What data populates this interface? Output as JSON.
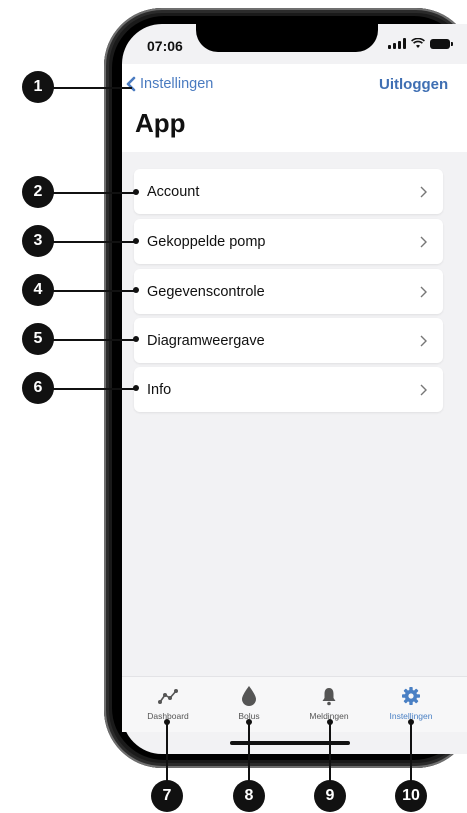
{
  "status_bar": {
    "time": "07:06"
  },
  "header": {
    "back_label": "Instellingen",
    "logout_label": "Uitloggen",
    "title": "App"
  },
  "menu": {
    "items": [
      {
        "label": "Account"
      },
      {
        "label": "Gekoppelde pomp"
      },
      {
        "label": "Gegevenscontrole"
      },
      {
        "label": "Diagramweergave"
      },
      {
        "label": "Info"
      }
    ]
  },
  "tabbar": {
    "tabs": [
      {
        "label": "Dashboard",
        "icon": "dashboard-icon"
      },
      {
        "label": "Bolus",
        "icon": "drop-icon"
      },
      {
        "label": "Meldingen",
        "icon": "bell-icon"
      },
      {
        "label": "Instellingen",
        "icon": "gear-icon",
        "active": true
      }
    ]
  },
  "callouts": [
    "1",
    "2",
    "3",
    "4",
    "5",
    "6",
    "7",
    "8",
    "9",
    "10"
  ],
  "colors": {
    "accent": "#4a80c4",
    "background": "#f2f2f4",
    "callout": "#111111"
  }
}
